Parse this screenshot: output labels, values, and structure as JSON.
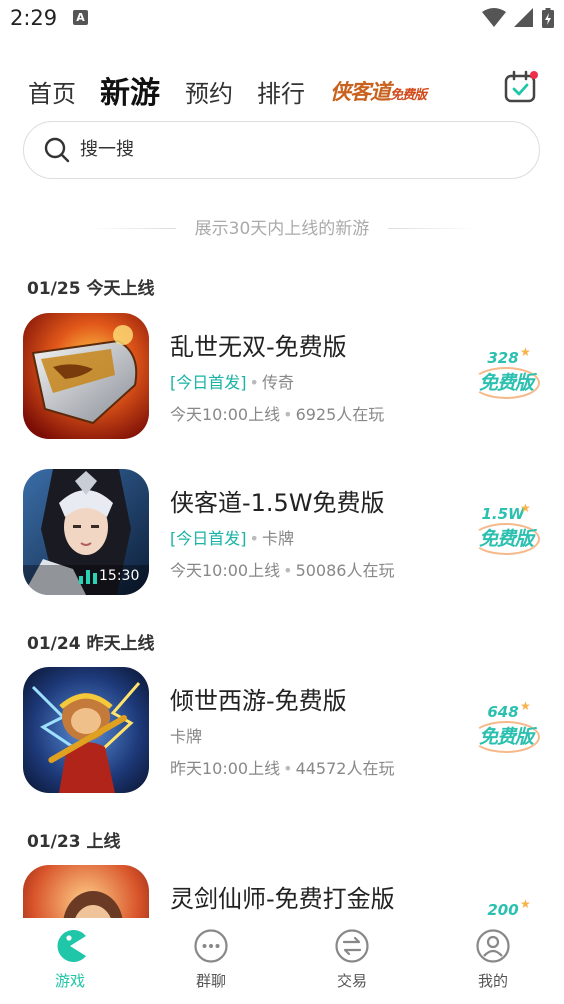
{
  "status": {
    "time": "2:29",
    "notif_icon": "A"
  },
  "nav": {
    "tabs": [
      {
        "label": "首页"
      },
      {
        "label": "新游"
      },
      {
        "label": "预约"
      },
      {
        "label": "排行"
      }
    ],
    "promo_logo": "侠客道",
    "promo_logo_sub": "免费版",
    "active_tab": "新游"
  },
  "search": {
    "placeholder": "搜一搜"
  },
  "hint": "展示30天内上线的新游",
  "sections": [
    {
      "date_label": "01/25 今天上线",
      "games": [
        {
          "title": "乱世无双-免费版",
          "first_tag": "[今日首发]",
          "genre": "传奇",
          "online_time": "今天10:00上线",
          "players": "6925人在玩",
          "badge_num": "328",
          "badge_free": "免费版"
        },
        {
          "title": "侠客道-1.5W免费版",
          "first_tag": "[今日首发]",
          "genre": "卡牌",
          "online_time": "今天10:00上线",
          "players": "50086人在玩",
          "badge_num": "1.5W",
          "badge_free": "免费版",
          "video_duration": "15:30"
        }
      ]
    },
    {
      "date_label": "01/24 昨天上线",
      "games": [
        {
          "title": "倾世西游-免费版",
          "genre": "卡牌",
          "online_time": "昨天10:00上线",
          "players": "44572人在玩",
          "badge_num": "648",
          "badge_free": "免费版"
        }
      ]
    },
    {
      "date_label": "01/23 上线",
      "games": [
        {
          "title": "灵剑仙师-免费打金版",
          "badge_num": "200"
        }
      ]
    }
  ],
  "bottom_nav": [
    {
      "label": "游戏",
      "active": true
    },
    {
      "label": "群聊"
    },
    {
      "label": "交易"
    },
    {
      "label": "我的"
    }
  ],
  "colors": {
    "accent": "#1fc6a8",
    "tag_teal": "#1ab3a6",
    "badge_orange": "#f6b98a"
  }
}
